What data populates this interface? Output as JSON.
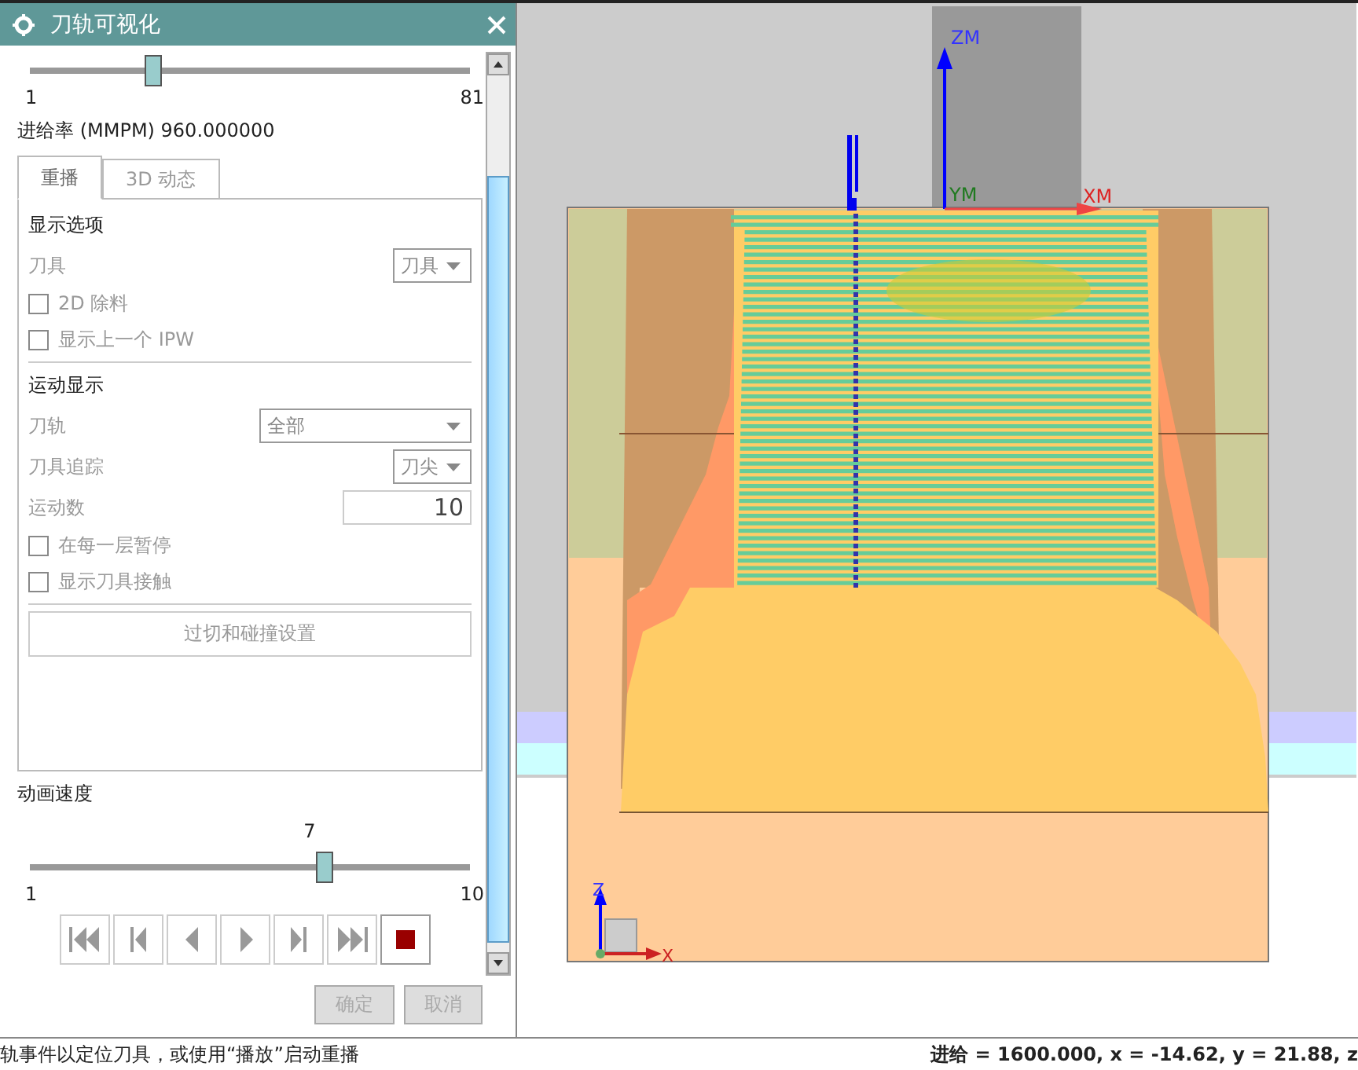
{
  "window": {
    "title": "刀轨可视化"
  },
  "step_slider": {
    "level": 0.28,
    "min_label": "1",
    "max_label": "81"
  },
  "feed_rate": "进给率 (MMPM) 960.000000",
  "tabs": [
    {
      "label": "重播",
      "selected": true
    },
    {
      "label": "3D 动态",
      "selected": false
    }
  ],
  "display_options": {
    "heading": "显示选项",
    "rows": [
      {
        "kind": "dropdown",
        "label": "刀具",
        "value": "刀具",
        "disabled": true
      },
      {
        "kind": "checkbox",
        "label": "2D 除料",
        "checked": false,
        "disabled": true
      },
      {
        "kind": "checkbox",
        "label": "显示上一个 IPW",
        "checked": false,
        "disabled": true
      }
    ]
  },
  "motion_display": {
    "heading": "运动显示",
    "rows": [
      {
        "kind": "wide-dropdown",
        "label": "刀轨",
        "value": "全部",
        "disabled": true
      },
      {
        "kind": "dropdown",
        "label": "刀具追踪",
        "value": "刀尖",
        "disabled": true
      },
      {
        "kind": "number",
        "label": "运动数",
        "value": "10",
        "disabled": true
      },
      {
        "kind": "checkbox",
        "label": "在每一层暂停",
        "checked": false,
        "disabled": true
      },
      {
        "kind": "checkbox",
        "label": "显示刀具接触",
        "checked": false,
        "disabled": true
      }
    ]
  },
  "settings_button": {
    "label": "过切和碰撞设置",
    "disabled": true
  },
  "animation_speed": {
    "label": "动画速度",
    "value": "7",
    "level": 0.667,
    "min_label": "1",
    "max_label": "10"
  },
  "playback_controls": [
    {
      "kind": "first",
      "disabled": true
    },
    {
      "kind": "step-back",
      "disabled": true
    },
    {
      "kind": "reverse",
      "disabled": true
    },
    {
      "kind": "play",
      "disabled": true
    },
    {
      "kind": "step-forward",
      "disabled": true
    },
    {
      "kind": "last",
      "disabled": true
    },
    {
      "kind": "stop",
      "disabled": false
    }
  ],
  "dialog_buttons": [
    {
      "label": "确定",
      "disabled": true
    },
    {
      "label": "取消",
      "disabled": true
    }
  ],
  "viewport": {
    "axis_labels": {
      "zm": "ZM",
      "ym": "YM",
      "xm": "XM",
      "z": "Z",
      "x": "X"
    }
  },
  "status_bar": {
    "prompt": "轨事件以定位刀具，或使用“播放”启动重播",
    "readout": "进给 = 1600.000, x = -14.62, y = 21.88, z"
  }
}
